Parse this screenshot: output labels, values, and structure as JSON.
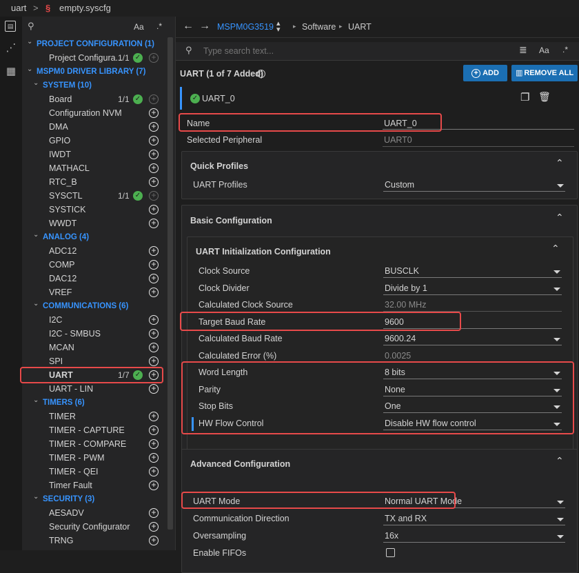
{
  "breadcrumb": {
    "part1": "uart",
    "sep": ">",
    "file_icon": "sysconfig-icon",
    "file": "empty.syscfg"
  },
  "activity_bar": {
    "items": [
      "editor-icon",
      "topology-icon",
      "calculator-icon"
    ]
  },
  "sidebar": {
    "search_icon": "search-icon",
    "case_icon": "Aa",
    "regex_icon": ".*",
    "groups": [
      {
        "label": "PROJECT CONFIGURATION (1)",
        "items": [
          {
            "label": "Project Configura...",
            "count": "1/1",
            "check": true,
            "add_disabled": true
          }
        ]
      },
      {
        "label": "MSPM0 DRIVER LIBRARY (7)",
        "subgroups": [
          {
            "label": "SYSTEM (10)",
            "items": [
              {
                "label": "Board",
                "count": "1/1",
                "check": true,
                "add_disabled": true
              },
              {
                "label": "Configuration NVM"
              },
              {
                "label": "DMA"
              },
              {
                "label": "GPIO"
              },
              {
                "label": "IWDT"
              },
              {
                "label": "MATHACL"
              },
              {
                "label": "RTC_B"
              },
              {
                "label": "SYSCTL",
                "count": "1/1",
                "check": true,
                "add_disabled": true
              },
              {
                "label": "SYSTICK"
              },
              {
                "label": "WWDT"
              }
            ]
          },
          {
            "label": "ANALOG (4)",
            "items": [
              {
                "label": "ADC12"
              },
              {
                "label": "COMP"
              },
              {
                "label": "DAC12"
              },
              {
                "label": "VREF"
              }
            ]
          },
          {
            "label": "COMMUNICATIONS (6)",
            "items": [
              {
                "label": "I2C"
              },
              {
                "label": "I2C - SMBUS"
              },
              {
                "label": "MCAN"
              },
              {
                "label": "SPI"
              },
              {
                "label": "UART",
                "count": "1/7",
                "check": true,
                "selected": true
              },
              {
                "label": "UART - LIN"
              }
            ]
          },
          {
            "label": "TIMERS (6)",
            "items": [
              {
                "label": "TIMER"
              },
              {
                "label": "TIMER - CAPTURE"
              },
              {
                "label": "TIMER - COMPARE"
              },
              {
                "label": "TIMER - PWM"
              },
              {
                "label": "TIMER - QEI"
              },
              {
                "label": "Timer Fault"
              }
            ]
          },
          {
            "label": "SECURITY (3)",
            "items": [
              {
                "label": "AESADV"
              },
              {
                "label": "Security Configurator"
              },
              {
                "label": "TRNG"
              }
            ]
          }
        ]
      }
    ]
  },
  "nav": {
    "back": "←",
    "forward": "→",
    "device": "MSPM0G3519",
    "path_sep": "▸",
    "path1": "Software",
    "path2": "UART"
  },
  "search": {
    "placeholder": "Type search text..."
  },
  "module": {
    "title": "UART (1 of 7 Added)",
    "help_icon": "?",
    "add_label": "ADD",
    "remove_label": "REMOVE ALL",
    "instance": "UART_0",
    "name_label": "Name",
    "name_value": "UART_0",
    "periph_label": "Selected Peripheral",
    "periph_value": "UART0"
  },
  "quick_profiles": {
    "title": "Quick Profiles",
    "rows": [
      {
        "label": "UART Profiles",
        "value": "Custom",
        "dropdown": true
      }
    ]
  },
  "basic": {
    "title": "Basic Configuration",
    "sub_title": "UART Initialization Configuration",
    "rows": [
      {
        "label": "Clock Source",
        "value": "BUSCLK",
        "dropdown": true
      },
      {
        "label": "Clock Divider",
        "value": "Divide by 1",
        "dropdown": true
      },
      {
        "label": "Calculated Clock Source",
        "value": "32.00 MHz",
        "readonly": true
      },
      {
        "label": "Target Baud Rate",
        "value": "9600"
      },
      {
        "label": "Calculated Baud Rate",
        "value": "9600.24",
        "dropdown": true
      },
      {
        "label": "Calculated Error (%)",
        "value": "0.0025",
        "readonly": true
      },
      {
        "label": "Word Length",
        "value": "8 bits",
        "dropdown": true
      },
      {
        "label": "Parity",
        "value": "None",
        "dropdown": true
      },
      {
        "label": "Stop Bits",
        "value": "One",
        "dropdown": true
      },
      {
        "label": "HW Flow Control",
        "value": "Disable HW flow control",
        "dropdown": true
      }
    ]
  },
  "advanced": {
    "title": "Advanced Configuration",
    "rows": [
      {
        "label": "UART Mode",
        "value": "Normal UART Mode",
        "dropdown": true
      },
      {
        "label": "Communication Direction",
        "value": "TX and RX",
        "dropdown": true
      },
      {
        "label": "Oversampling",
        "value": "16x",
        "dropdown": true
      },
      {
        "label": "Enable FIFOs",
        "value": "",
        "checkbox": true
      }
    ]
  },
  "colors": {
    "accent": "#3794ff",
    "check": "#4caf50",
    "highlight": "#e84a4a",
    "button": "#1b6fb3"
  }
}
